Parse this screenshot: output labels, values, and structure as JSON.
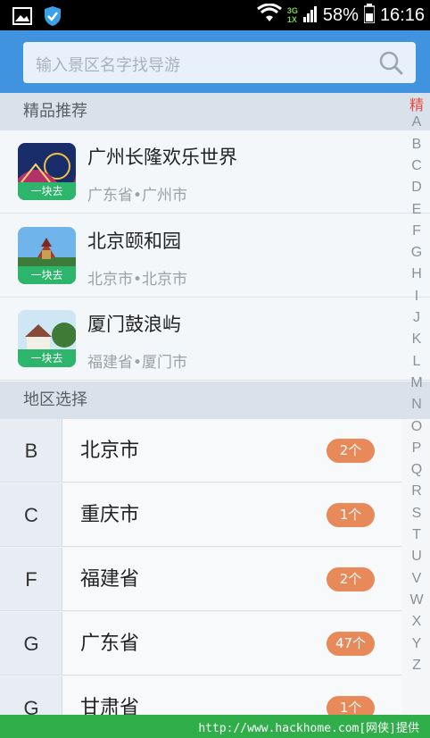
{
  "status_bar": {
    "network_top": "3G",
    "network_bottom": "1X",
    "battery": "58%",
    "time": "16:16"
  },
  "search": {
    "placeholder": "输入景区名字找导游"
  },
  "sections": {
    "recommended": "精品推荐",
    "region": "地区选择"
  },
  "recommended": [
    {
      "title": "广州长隆欢乐世界",
      "location": "广东省•广州市",
      "badge": "一块去"
    },
    {
      "title": "北京颐和园",
      "location": "北京市•北京市",
      "badge": "一块去"
    },
    {
      "title": "厦门鼓浪屿",
      "location": "福建省•厦门市",
      "badge": "一块去"
    }
  ],
  "regions": [
    {
      "letter": "B",
      "name": "北京市",
      "count": "2个"
    },
    {
      "letter": "C",
      "name": "重庆市",
      "count": "1个"
    },
    {
      "letter": "F",
      "name": "福建省",
      "count": "2个"
    },
    {
      "letter": "G",
      "name": "广东省",
      "count": "47个"
    },
    {
      "letter": "G",
      "name": "甘肃省",
      "count": "1个"
    }
  ],
  "index_bar": [
    "精",
    "A",
    "B",
    "C",
    "D",
    "E",
    "F",
    "G",
    "H",
    "I",
    "J",
    "K",
    "L",
    "M",
    "N",
    "O",
    "P",
    "Q",
    "R",
    "S",
    "T",
    "U",
    "V",
    "W",
    "X",
    "Y",
    "Z"
  ],
  "colors": {
    "header_blue": "#3f93df",
    "badge_green": "#2db56c",
    "count_orange": "#e8895a",
    "index_active": "#e64a3c",
    "footer_green": "#2fae4a"
  },
  "footer": {
    "text": "http://www.hackhome.com[网侠]提供"
  }
}
